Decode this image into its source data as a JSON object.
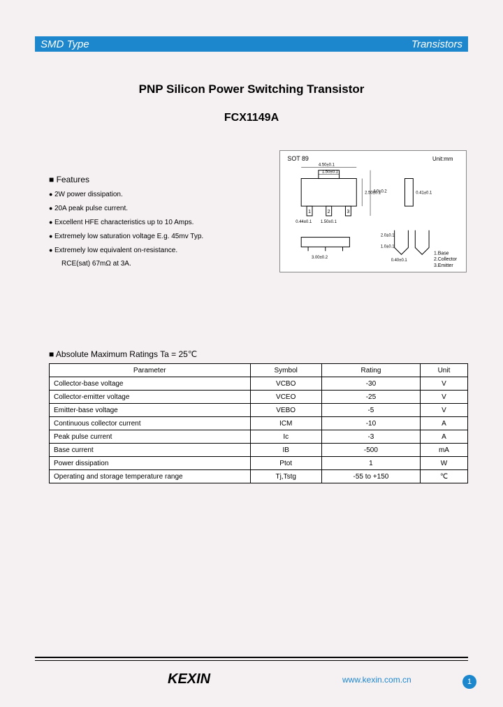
{
  "header": {
    "left": "SMD Type",
    "right": "Transistors"
  },
  "title": "PNP Silicon Power Switching Transistor",
  "part_no": "FCX1149A",
  "features": {
    "heading": "Features",
    "items": [
      "2W power dissipation.",
      "20A peak pulse current.",
      "Excellent HFE characteristics up to 10 Amps.",
      "Extremely low saturation voltage E.g. 45mv Typ.",
      "Extremely low equivalent on-resistance."
    ],
    "sub": "RCE(sat) 67mΩ at 3A."
  },
  "diagram": {
    "pkg": "SOT 89",
    "unit": "Unit:mm",
    "pins": "1.Base\n2.Collector\n3.Emitter",
    "dims": {
      "w": "4.50±0.1",
      "t": "1.50±0.1",
      "h1": "2.50±0.1",
      "h2": "4.0±0.2",
      "pw": "0.44±0.1",
      "pp": "1.50±0.1",
      "ph": "0.41±0.1",
      "bw": "3.00±0.2",
      "lh1": "2.0±0.1",
      "lh2": "1.0±0.1",
      "lw": "0.40±0.1"
    }
  },
  "ratings": {
    "heading": "Absolute Maximum Ratings Ta = 25℃",
    "cols": [
      "Parameter",
      "Symbol",
      "Rating",
      "Unit"
    ],
    "rows": [
      [
        "Collector-base voltage",
        "VCBO",
        "-30",
        "V"
      ],
      [
        "Collector-emitter voltage",
        "VCEO",
        "-25",
        "V"
      ],
      [
        "Emitter-base voltage",
        "VEBO",
        "-5",
        "V"
      ],
      [
        "Continuous collector current",
        "ICM",
        "-10",
        "A"
      ],
      [
        "Peak pulse current",
        "Ic",
        "-3",
        "A"
      ],
      [
        "Base current",
        "IB",
        "-500",
        "mA"
      ],
      [
        "Power dissipation",
        "Ptot",
        "1",
        "W"
      ],
      [
        "Operating and storage temperature range",
        "Tj,Tstg",
        "-55 to +150",
        "℃"
      ]
    ]
  },
  "footer": {
    "brand": "KEXIN",
    "url": "www.kexin.com.cn",
    "page": "1"
  }
}
